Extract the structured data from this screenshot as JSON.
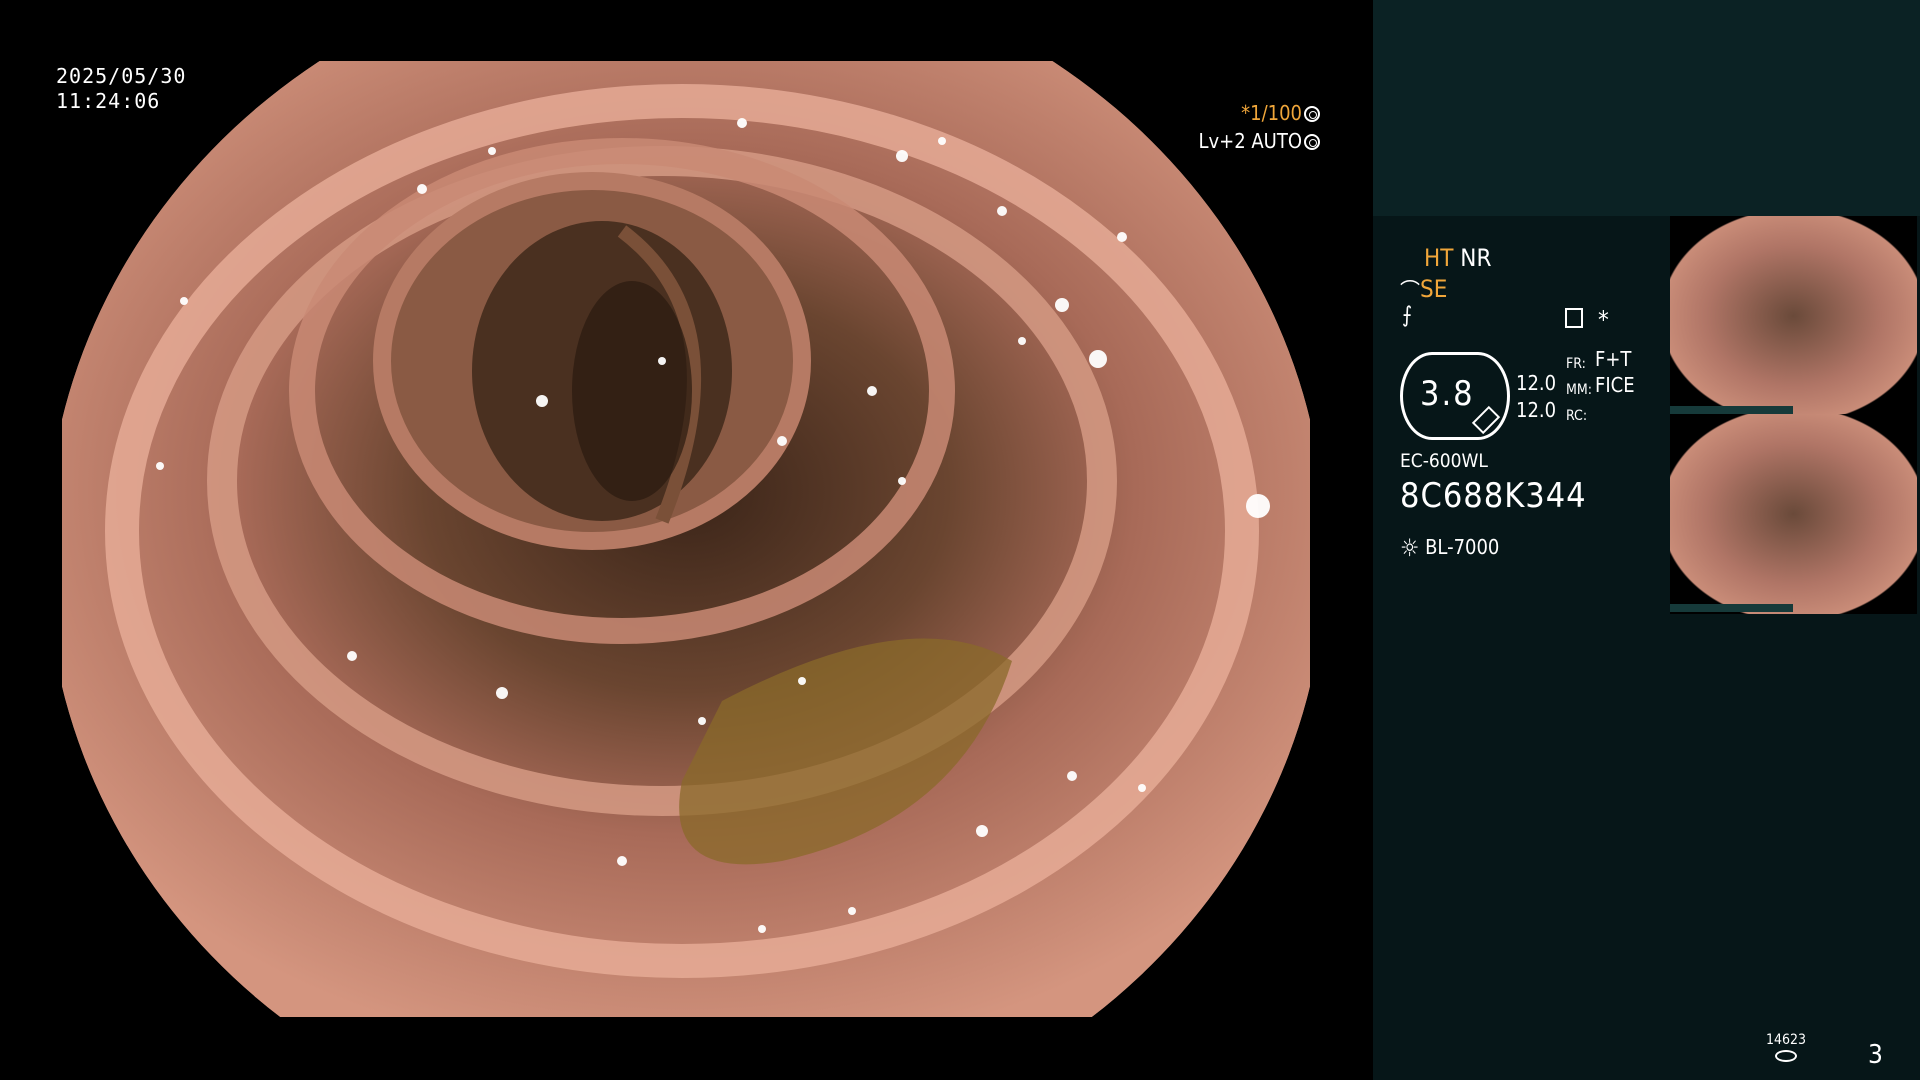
{
  "overlay": {
    "date": "2025/05/30",
    "time": "11:24:06",
    "shutter": "*1/100",
    "level": "Lv+2 AUTO"
  },
  "panel": {
    "ht": "HT",
    "nr": "NR",
    "se": "SE",
    "asterisk": "*",
    "zoom": "3.8",
    "zoom_num_1": "12.0",
    "zoom_num_2": "12.0",
    "fr_label": "FR:",
    "mm_label": "MM:",
    "rc_label": "RC:",
    "fr_value": "F+T",
    "mm_value": "FICE",
    "scope_model": "EC-600WL",
    "scope_serial": "8C688K344",
    "light_source": "BL-7000"
  },
  "footer": {
    "frame_count": "14623",
    "page_number": "3"
  },
  "colors": {
    "accent": "#f0a63a",
    "panel_bg": "#061618",
    "panel_top_bg": "#0b2224"
  }
}
